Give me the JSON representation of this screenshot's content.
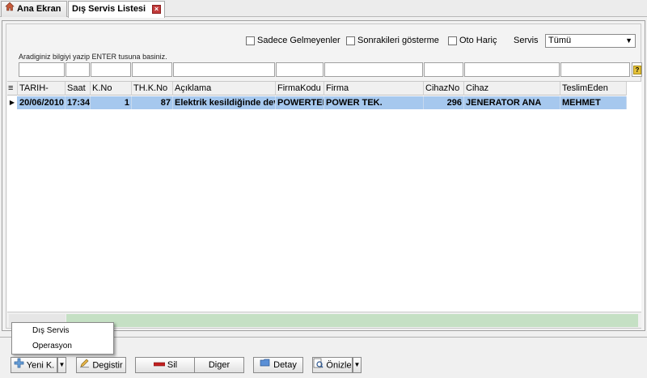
{
  "tabs": {
    "home_label": "Ana Ekran",
    "home_icon": "home-icon",
    "active_label": "Dış Servis Listesi",
    "close_icon": "close-icon"
  },
  "filters": {
    "sadece_gelmeyenler": "Sadece Gelmeyenler",
    "sonrakileri_gosterme": "Sonrakileri gösterme",
    "oto_haric": "Oto Hariç",
    "servis_label": "Servis",
    "servis_value": "Tümü"
  },
  "hint": "Aradiginiz bilgiyi yazip ENTER tusuna basiniz.",
  "grid": {
    "columns": [
      "TARIH-",
      "Saat",
      "K.No",
      "TH.K.No",
      "Açıklama",
      "FirmaKodu",
      "Firma",
      "CihazNo",
      "Cihaz",
      "TeslimEden"
    ],
    "rows": [
      [
        "20/06/2010",
        "17:34",
        "1",
        "87",
        "Elektrik kesildiğinde devr",
        "POWERTEK",
        "POWER TEK.",
        "296",
        "JENERATOR ANA",
        "MEHMET"
      ]
    ]
  },
  "buttons": {
    "yeni": "Yeni K.",
    "degistir": "Degistir",
    "sil": "Sil",
    "diger": "Diger",
    "detay": "Detay",
    "onizle": "Önizle"
  },
  "popup": [
    "Dış Servis",
    "Operasyon"
  ],
  "colors": {
    "selected_row": "#a6c8ee",
    "scroll_green": "#c5e0c4",
    "close_red": "#c23b3b"
  }
}
